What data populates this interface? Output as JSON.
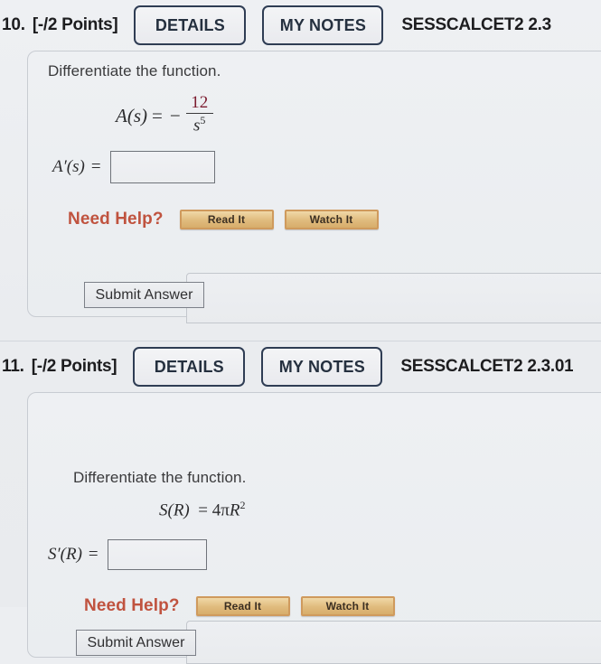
{
  "problems": [
    {
      "number": "10.",
      "points": "[-/2 Points]",
      "details_label": "DETAILS",
      "notes_label": "MY NOTES",
      "source": "SESSCALCET2 2.3",
      "prompt": "Differentiate the function.",
      "equation": {
        "lhs": "A(s)",
        "equals": "=",
        "sign": "−",
        "numerator": "12",
        "denominator": "s",
        "denominator_exponent": "5"
      },
      "answer_label": "A′(s)",
      "answer_equals": "=",
      "answer_value": "",
      "need_help_label": "Need Help?",
      "read_it_label": "Read It",
      "watch_it_label": "Watch It",
      "submit_label": "Submit Answer"
    },
    {
      "number": "11.",
      "points": "[-/2 Points]",
      "details_label": "DETAILS",
      "notes_label": "MY NOTES",
      "source": "SESSCALCET2 2.3.01",
      "prompt": "Differentiate the function.",
      "equation": {
        "lhs": "S(R)",
        "equals": "=",
        "coefficient": "4",
        "pi": "π",
        "variable": "R",
        "exponent": "2"
      },
      "answer_label": "S′(R)",
      "answer_equals": "=",
      "answer_value": "",
      "need_help_label": "Need Help?",
      "read_it_label": "Read It",
      "watch_it_label": "Watch It",
      "submit_label": "Submit Answer"
    }
  ],
  "colors": {
    "background": "#eef0f3",
    "need_help": "#c0533f",
    "numerator_accent": "#7b1b2e",
    "button_border": "#2f3d54",
    "help_button_border": "#cf9a5d"
  }
}
